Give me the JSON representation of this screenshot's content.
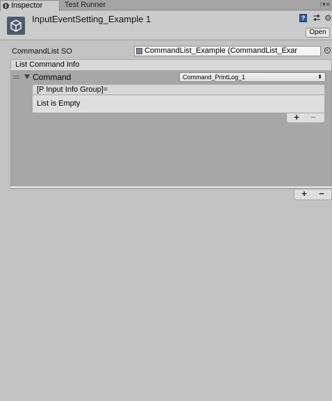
{
  "tabs": [
    {
      "label": "Inspector",
      "active": true
    },
    {
      "label": "Test Runner",
      "active": false
    }
  ],
  "tab_menu_glyph": "⁝▾≡",
  "header": {
    "title": "InputEventSetting_Example 1",
    "open_label": "Open",
    "icons": [
      "unity-logo-icon",
      "help-icon",
      "preset-icon",
      "gear-icon"
    ]
  },
  "properties": {
    "commandlist_label": "CommandList SO",
    "commandlist_value": "CommandList_Example (CommandList_Exar"
  },
  "list": {
    "header": "List Command Info",
    "element": {
      "label": "Command",
      "dropdown_value": "Command_PrintLog_1",
      "dropdown_arrow": "⬍",
      "inner_list_header": "[P Input Info Group]=",
      "inner_list_empty": "List is Empty"
    },
    "add_label": "+",
    "remove_label": "−"
  },
  "colors": {
    "background": "#c2c2c2",
    "panel": "#a7a7a7",
    "header_bg": "#d8d8d8"
  }
}
